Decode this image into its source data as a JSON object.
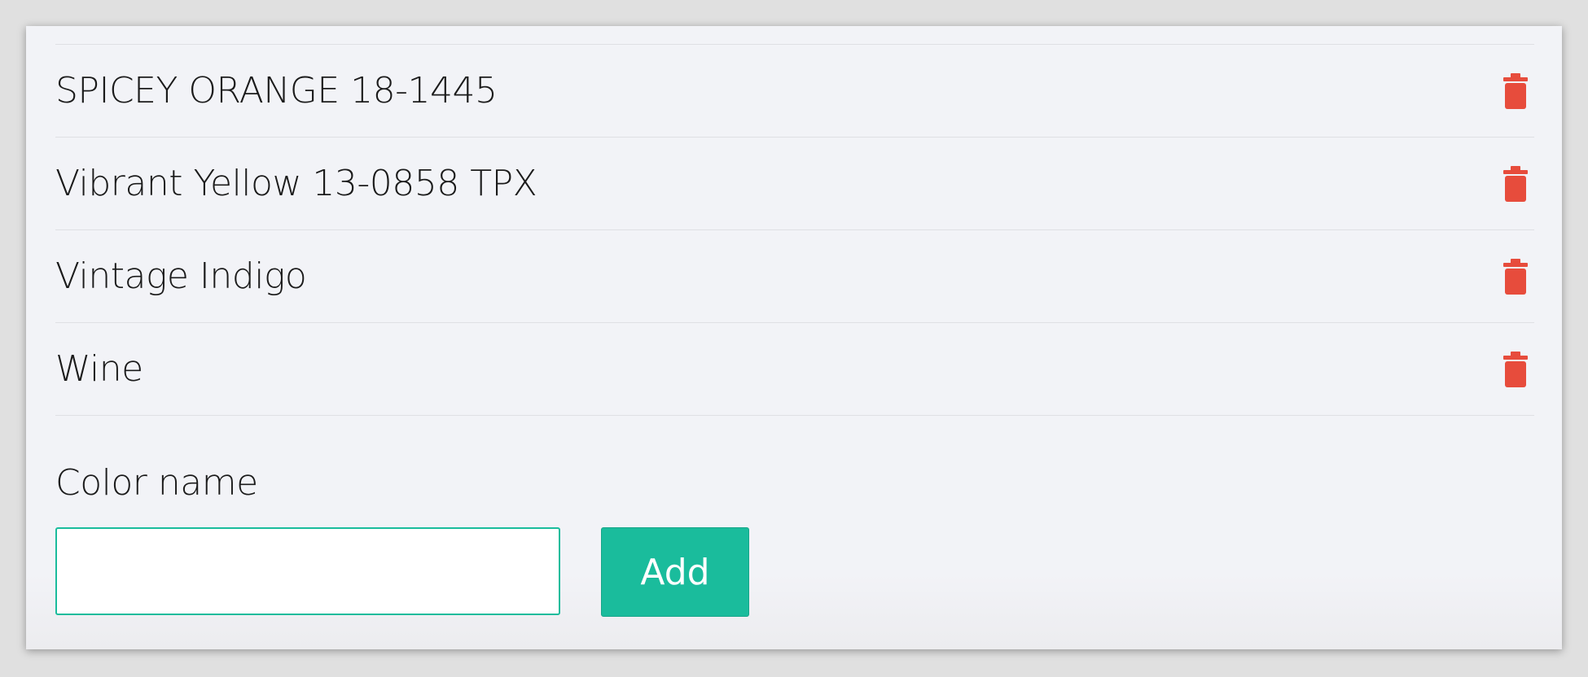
{
  "colors": {
    "items": [
      {
        "label": "SPICEY ORANGE 18-1445",
        "delete_icon": "trash-icon"
      },
      {
        "label": "Vibrant Yellow 13-0858 TPX",
        "delete_icon": "trash-icon"
      },
      {
        "label": "Vintage Indigo",
        "delete_icon": "trash-icon"
      },
      {
        "label": "Wine",
        "delete_icon": "trash-icon"
      }
    ]
  },
  "form": {
    "label": "Color name",
    "input_value": "",
    "input_placeholder": "",
    "add_label": "Add"
  },
  "theme": {
    "accent": "#1abc9c",
    "danger": "#e74c3c",
    "panel_bg": "#f2f3f7",
    "page_bg": "#e0e0e0"
  }
}
